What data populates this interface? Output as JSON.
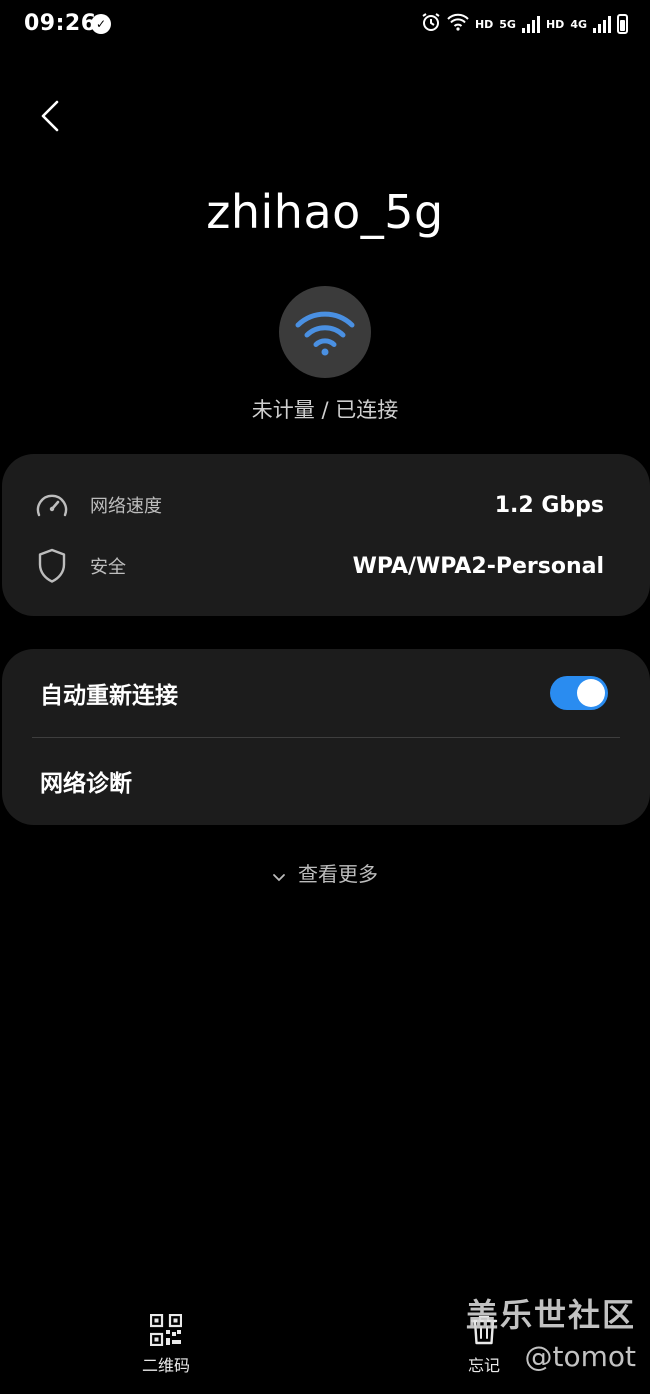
{
  "status_bar": {
    "time": "09:26",
    "hd1": "HD",
    "net1": "5G",
    "hd2": "HD",
    "net2": "4G"
  },
  "header": {
    "network_name": "zhihao_5g",
    "status": "未计量 / 已连接"
  },
  "info_card": {
    "speed_label": "网络速度",
    "speed_value": "1.2 Gbps",
    "security_label": "安全",
    "security_value": "WPA/WPA2-Personal"
  },
  "settings_card": {
    "auto_reconnect_label": "自动重新连接",
    "auto_reconnect_on": true,
    "diagnose_label": "网络诊断"
  },
  "see_more": "查看更多",
  "bottom_bar": {
    "qr_label": "二维码",
    "forget_label": "忘记"
  },
  "watermark": {
    "line1": "盖乐世社区",
    "line2": "@tomot"
  },
  "colors": {
    "accent": "#2a8cf0",
    "card_bg": "#1c1c1c",
    "background": "#000000"
  }
}
